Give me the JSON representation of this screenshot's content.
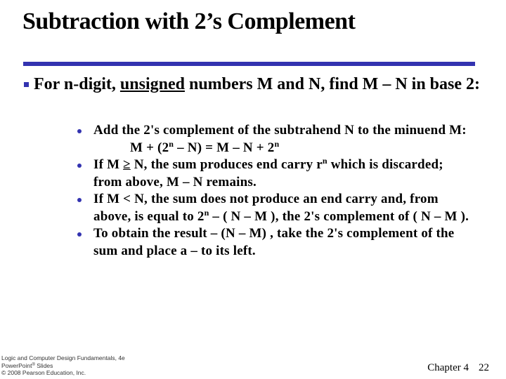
{
  "slide": {
    "title": "Subtraction with 2’s Complement",
    "accent_color": "#3333B0",
    "main_bullet": {
      "icon": "square-bullet-icon",
      "text_before": "For n-digit, ",
      "underlined": "unsigned",
      "text_after": " numbers M and N, find M – N in base 2:"
    },
    "sub_bullets": [
      {
        "icon": "dot-bullet-icon",
        "text": "Add the 2's complement of the subtrahend N  to the minuend M:",
        "formula": {
          "part1": "M + (2",
          "sup1": "n",
          "part2": " – N) = M – N + 2",
          "sup2": "n"
        }
      },
      {
        "icon": "dot-bullet-icon",
        "part1": "If M ",
        "geq": "≥",
        "part2": " N, the sum produces end carry r",
        "sup": "n",
        "part3": " which is discarded; from above, M – N remains."
      },
      {
        "icon": "dot-bullet-icon",
        "part1": "If M < N, the sum does not produce an end carry and, from above, is equal to 2",
        "sup": "n",
        "part2": " – ( N – M ), the 2's complement of ( N – M )."
      },
      {
        "icon": "dot-bullet-icon",
        "text": "To obtain the result – (N – M) , take the 2's complement of the sum and place a – to its left."
      }
    ]
  },
  "footer": {
    "line1": "Logic and Computer Design Fundamentals, 4e",
    "line2_a": "PowerPoint",
    "line2_sup": "®",
    "line2_b": " Slides",
    "line3": "© 2008 Pearson Education, Inc.",
    "chapter": "Chapter 4",
    "page": "22"
  }
}
